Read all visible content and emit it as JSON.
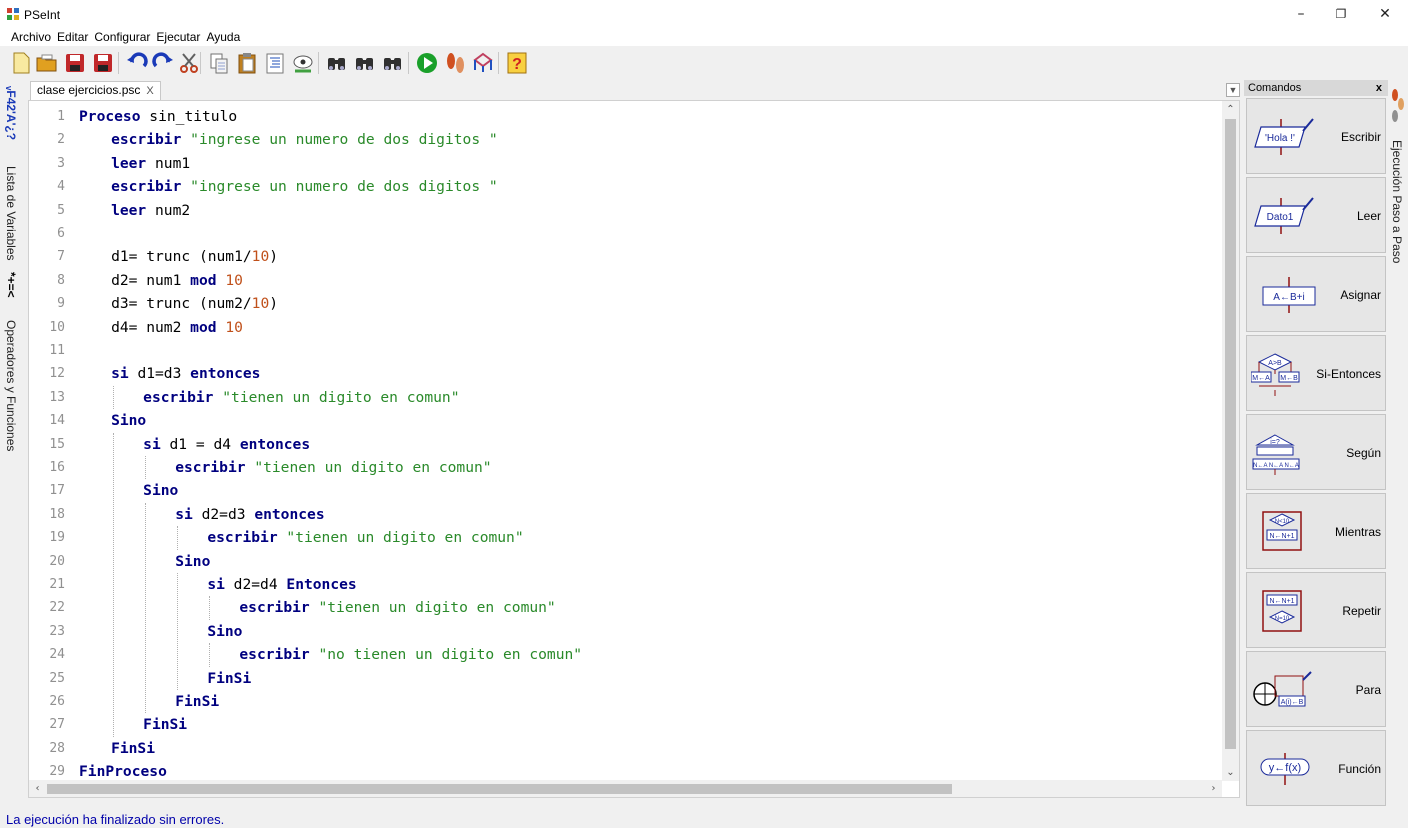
{
  "window": {
    "title": "PSeInt",
    "minimize": "–",
    "maximize": "❐",
    "close": "✕"
  },
  "menu": [
    "Archivo",
    "Editar",
    "Configurar",
    "Ejecutar",
    "Ayuda"
  ],
  "toolbar": [
    {
      "icon": "new-file-icon",
      "color": "#f8e9a0"
    },
    {
      "icon": "open-folder-icon",
      "color": "#e0a020"
    },
    {
      "icon": "save-icon",
      "color": "#c0282a"
    },
    {
      "icon": "save-as-icon",
      "color": "#c0282a"
    },
    {
      "icon": "undo-icon",
      "color": "#1a3ab8"
    },
    {
      "icon": "redo-icon",
      "color": "#1a3ab8"
    },
    {
      "icon": "cut-icon",
      "color": "#606060"
    },
    {
      "icon": "copy-icon",
      "color": "#707070"
    },
    {
      "icon": "paste-icon",
      "color": "#c08020"
    },
    {
      "icon": "indent-icon",
      "color": "#6a8ad0"
    },
    {
      "icon": "comment-icon",
      "color": "#40a040"
    },
    {
      "icon": "find-icon",
      "color": "#303030"
    },
    {
      "icon": "find-next-icon",
      "color": "#303030"
    },
    {
      "icon": "replace-icon",
      "color": "#303030"
    },
    {
      "icon": "run-icon",
      "color": "#1aa02a"
    },
    {
      "icon": "step-by-step-icon",
      "color": "#d05020"
    },
    {
      "icon": "flowchart-icon",
      "color": "#c04060"
    },
    {
      "icon": "help-icon",
      "color": "#d02020"
    }
  ],
  "left_tabs": {
    "variables_icon": "*+=<",
    "variables_label": "Lista de Variables",
    "operators_label": "Operadores y Funciones",
    "top_icons": "ᵥF42'A'¿?"
  },
  "file_tab": {
    "label": "clase ejercicios.psc",
    "close": "X"
  },
  "code_lines": [
    {
      "n": "1",
      "indent": 0,
      "tokens": [
        [
          "kw",
          "Proceso"
        ],
        [
          "t",
          " sin_titulo"
        ]
      ]
    },
    {
      "n": "2",
      "indent": 1,
      "tokens": [
        [
          "kw",
          "escribir"
        ],
        [
          "t",
          " "
        ],
        [
          "str",
          "\"ingrese un numero de dos digitos \""
        ]
      ]
    },
    {
      "n": "3",
      "indent": 1,
      "tokens": [
        [
          "kw",
          "leer"
        ],
        [
          "t",
          " num1"
        ]
      ]
    },
    {
      "n": "4",
      "indent": 1,
      "tokens": [
        [
          "kw",
          "escribir"
        ],
        [
          "t",
          " "
        ],
        [
          "str",
          "\"ingrese un numero de dos digitos \""
        ]
      ]
    },
    {
      "n": "5",
      "indent": 1,
      "tokens": [
        [
          "kw",
          "leer"
        ],
        [
          "t",
          " num2"
        ]
      ]
    },
    {
      "n": "6",
      "indent": 1,
      "tokens": []
    },
    {
      "n": "7",
      "indent": 1,
      "tokens": [
        [
          "t",
          "d1= trunc (num1/"
        ],
        [
          "num",
          "10"
        ],
        [
          "t",
          ")"
        ]
      ]
    },
    {
      "n": "8",
      "indent": 1,
      "tokens": [
        [
          "t",
          "d2= num1 "
        ],
        [
          "kw",
          "mod"
        ],
        [
          "t",
          " "
        ],
        [
          "num",
          "10"
        ]
      ]
    },
    {
      "n": "9",
      "indent": 1,
      "tokens": [
        [
          "t",
          "d3= trunc (num2/"
        ],
        [
          "num",
          "10"
        ],
        [
          "t",
          ")"
        ]
      ]
    },
    {
      "n": "10",
      "indent": 1,
      "tokens": [
        [
          "t",
          "d4= num2 "
        ],
        [
          "kw",
          "mod"
        ],
        [
          "t",
          " "
        ],
        [
          "num",
          "10"
        ]
      ]
    },
    {
      "n": "11",
      "indent": 1,
      "tokens": []
    },
    {
      "n": "12",
      "indent": 1,
      "tokens": [
        [
          "kw",
          "si"
        ],
        [
          "t",
          " d1=d3 "
        ],
        [
          "kw",
          "entonces"
        ]
      ]
    },
    {
      "n": "13",
      "indent": 2,
      "tokens": [
        [
          "kw",
          "escribir"
        ],
        [
          "t",
          " "
        ],
        [
          "str",
          "\"tienen un digito en comun\""
        ]
      ]
    },
    {
      "n": "14",
      "indent": 1,
      "tokens": [
        [
          "kw",
          "Sino"
        ]
      ]
    },
    {
      "n": "15",
      "indent": 2,
      "tokens": [
        [
          "kw",
          "si"
        ],
        [
          "t",
          " d1 = d4 "
        ],
        [
          "kw",
          "entonces"
        ]
      ]
    },
    {
      "n": "16",
      "indent": 3,
      "tokens": [
        [
          "kw",
          "escribir"
        ],
        [
          "t",
          " "
        ],
        [
          "str",
          "\"tienen un digito en comun\""
        ]
      ]
    },
    {
      "n": "17",
      "indent": 2,
      "tokens": [
        [
          "kw",
          "Sino"
        ]
      ]
    },
    {
      "n": "18",
      "indent": 3,
      "tokens": [
        [
          "kw",
          "si"
        ],
        [
          "t",
          " d2=d3 "
        ],
        [
          "kw",
          "entonces"
        ]
      ]
    },
    {
      "n": "19",
      "indent": 4,
      "tokens": [
        [
          "kw",
          "escribir"
        ],
        [
          "t",
          " "
        ],
        [
          "str",
          "\"tienen un digito en comun\""
        ]
      ]
    },
    {
      "n": "20",
      "indent": 3,
      "tokens": [
        [
          "kw",
          "Sino"
        ]
      ]
    },
    {
      "n": "21",
      "indent": 4,
      "tokens": [
        [
          "kw",
          "si"
        ],
        [
          "t",
          " d2=d4 "
        ],
        [
          "kw",
          "Entonces"
        ]
      ]
    },
    {
      "n": "22",
      "indent": 5,
      "tokens": [
        [
          "kw",
          "escribir"
        ],
        [
          "t",
          " "
        ],
        [
          "str",
          "\"tienen un digito en comun\""
        ]
      ]
    },
    {
      "n": "23",
      "indent": 4,
      "tokens": [
        [
          "kw",
          "Sino"
        ]
      ]
    },
    {
      "n": "24",
      "indent": 5,
      "tokens": [
        [
          "kw",
          "escribir"
        ],
        [
          "t",
          " "
        ],
        [
          "str",
          "\"no tienen un digito en comun\""
        ]
      ]
    },
    {
      "n": "25",
      "indent": 4,
      "tokens": [
        [
          "kw",
          "FinSi"
        ]
      ]
    },
    {
      "n": "26",
      "indent": 3,
      "tokens": [
        [
          "kw",
          "FinSi"
        ]
      ]
    },
    {
      "n": "27",
      "indent": 2,
      "tokens": [
        [
          "kw",
          "FinSi"
        ]
      ]
    },
    {
      "n": "28",
      "indent": 1,
      "tokens": [
        [
          "kw",
          "FinSi"
        ]
      ]
    },
    {
      "n": "29",
      "indent": 0,
      "tokens": [
        [
          "kw",
          "FinProceso"
        ]
      ]
    }
  ],
  "commands_panel": {
    "title": "Comandos",
    "close": "x",
    "items": [
      {
        "label": "Escribir",
        "icon": "escribir-icon",
        "glyph": "'Hola !'"
      },
      {
        "label": "Leer",
        "icon": "leer-icon",
        "glyph": "Dato1"
      },
      {
        "label": "Asignar",
        "icon": "asignar-icon",
        "glyph": "A←B+i"
      },
      {
        "label": "Si-Entonces",
        "icon": "si-entonces-icon",
        "glyph": "A>B"
      },
      {
        "label": "Según",
        "icon": "segun-icon",
        "glyph": "i=?"
      },
      {
        "label": "Mientras",
        "icon": "mientras-icon",
        "glyph": "N<10"
      },
      {
        "label": "Repetir",
        "icon": "repetir-icon",
        "glyph": "N=10"
      },
      {
        "label": "Para",
        "icon": "para-icon",
        "glyph": "A(i)←B"
      },
      {
        "label": "Función",
        "icon": "funcion-icon",
        "glyph": "y←f(x)"
      }
    ]
  },
  "right_tab": {
    "label": "Ejecución Paso a Paso"
  },
  "status": {
    "text": "La ejecución ha finalizado sin errores.",
    "color": "#0000aa"
  },
  "colors": {
    "keyword": "#00007f",
    "string": "#2a8a2a",
    "number": "#c0501a",
    "line_number": "#909090"
  }
}
